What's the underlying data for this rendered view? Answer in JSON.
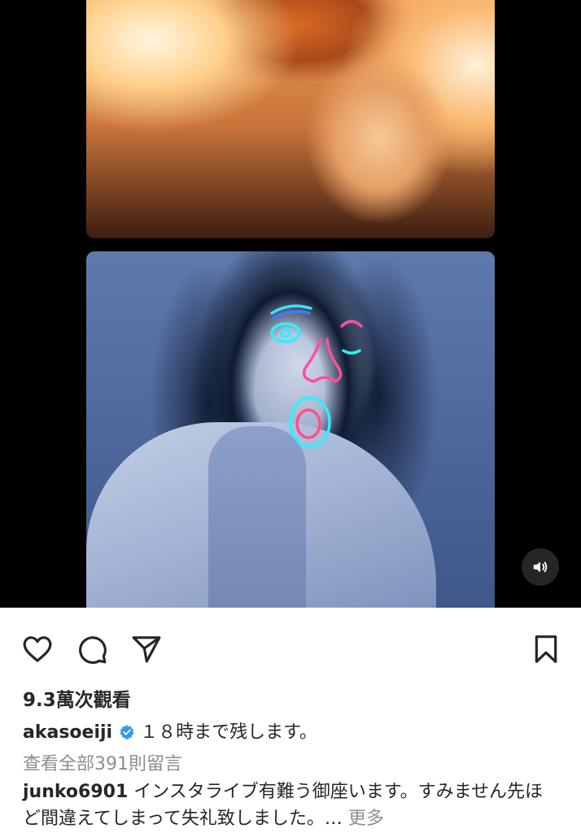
{
  "live": {
    "top_participant": "host-camera",
    "bottom_participant": "guest-camera-with-neon-face-filter"
  },
  "icons": {
    "like": "heart-icon",
    "comment": "speech-bubble-icon",
    "share": "paper-plane-icon",
    "save": "bookmark-icon",
    "sound": "speaker-icon",
    "verified": "verified-badge-icon"
  },
  "post": {
    "views": "9.3萬次觀看",
    "author": "akasoeiji",
    "caption": "１８時まで残します。",
    "view_all_comments": "查看全部391則留言"
  },
  "comment": {
    "author": "junko6901",
    "text": "インスタライブ有難う御座います。すみません先ほど間違えてしまって失礼致しました。…",
    "more_label": "更多"
  },
  "colors": {
    "text": "#262626",
    "secondary_text": "#8e8e8e",
    "verified_blue": "#3897f0",
    "media_background": "#000000"
  }
}
